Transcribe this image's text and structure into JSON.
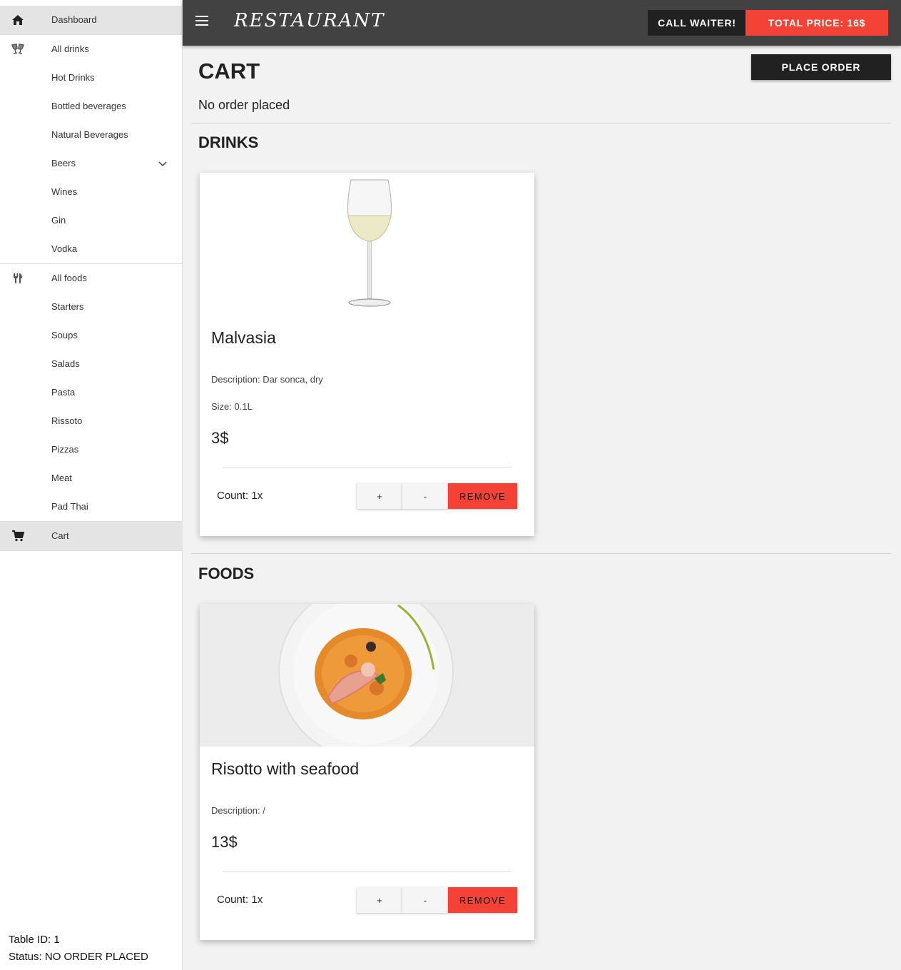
{
  "header": {
    "brand": "RESTAURANT",
    "call_waiter_label": "CALL WAITER!",
    "total_price_label": "TOTAL PRICE: 16$"
  },
  "sidebar": {
    "items": [
      {
        "label": "Dashboard",
        "icon": "home-icon"
      },
      {
        "label": "All drinks",
        "icon": "glasses-icon"
      },
      {
        "label": "Hot Drinks"
      },
      {
        "label": "Bottled beverages"
      },
      {
        "label": "Natural Beverages"
      },
      {
        "label": "Beers",
        "icon": "chevron-down-icon"
      },
      {
        "label": "Wines"
      },
      {
        "label": "Gin"
      },
      {
        "label": "Vodka"
      },
      {
        "label": "All foods",
        "icon": "cutlery-icon"
      },
      {
        "label": "Starters"
      },
      {
        "label": "Soups"
      },
      {
        "label": "Salads"
      },
      {
        "label": "Pasta"
      },
      {
        "label": "Rissoto"
      },
      {
        "label": "Pizzas"
      },
      {
        "label": "Meat"
      },
      {
        "label": "Pad Thai"
      },
      {
        "label": "Cart",
        "icon": "cart-icon"
      }
    ],
    "footer": {
      "table_id": "Table ID: 1",
      "status": "Status: NO ORDER PLACED"
    }
  },
  "main": {
    "title": "CART",
    "place_order_label": "PLACE ORDER",
    "order_status": "No order placed",
    "drinks_heading": "DRINKS",
    "foods_heading": "FOODS",
    "drinks": [
      {
        "name": "Malvasia",
        "description": "Description: Dar sonca, dry",
        "size": "Size: 0.1L",
        "price": "3$",
        "count": "Count: 1x",
        "plus": "+",
        "minus": "-",
        "remove": "REMOVE"
      }
    ],
    "foods": [
      {
        "name": "Risotto with seafood",
        "description": "Description: /",
        "price": "13$",
        "count": "Count: 1x",
        "plus": "+",
        "minus": "-",
        "remove": "REMOVE"
      }
    ]
  },
  "colors": {
    "header_bg": "#424242",
    "accent_red": "#f44336",
    "dark_button": "#212121",
    "active_nav": "#e4e4e4"
  }
}
